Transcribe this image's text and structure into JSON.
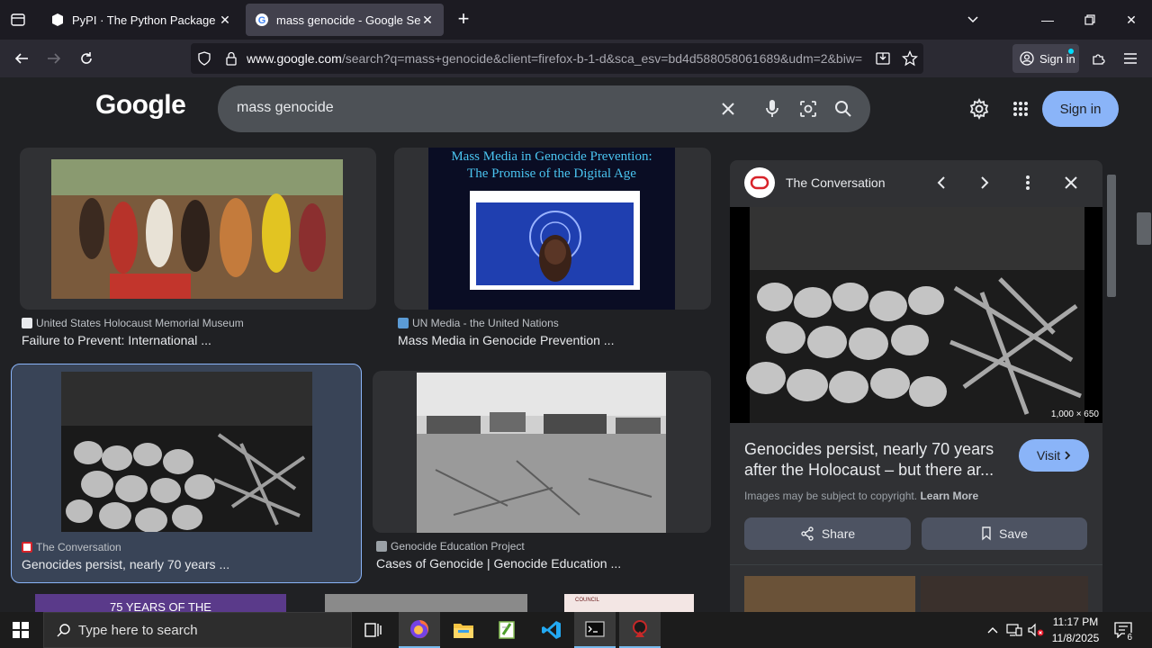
{
  "browser": {
    "tabs": [
      {
        "title": "PyPI · The Python Package Index",
        "active": false
      },
      {
        "title": "mass genocide - Google Search",
        "active": true
      }
    ],
    "url_host": "www.google.com",
    "url_rest": "/search?q=mass+genocide&client=firefox-b-1-d&sca_esv=bd4d588058061689&udm=2&biw=",
    "signin_label": "Sign in"
  },
  "google": {
    "logo": "Google",
    "query": "mass genocide",
    "signin_label": "Sign in"
  },
  "results": [
    {
      "source": "United States Holocaust Memorial Museum",
      "title": "Failure to Prevent: International ..."
    },
    {
      "source": "UN Media - the United Nations",
      "title": "Mass Media in Genocide Prevention ...",
      "image_caption_line1": "Mass Media in Genocide Prevention:",
      "image_caption_line2": "The Promise of the Digital Age"
    },
    {
      "source": "The Conversation",
      "title": "Genocides persist, nearly 70 years ...",
      "selected": true
    },
    {
      "source": "Genocide Education Project",
      "title": "Cases of Genocide | Genocide Education ..."
    },
    {
      "partial_text": "75 YEARS OF THE"
    },
    {
      "partial_text": "COUNCIL"
    }
  ],
  "panel": {
    "site": "The Conversation",
    "dimensions": "1,000 × 650",
    "title": "Genocides persist, nearly 70 years after the Holocaust – but there ar...",
    "visit_label": "Visit",
    "copyright_text": "Images may be subject to copyright.",
    "learn_more": "Learn More",
    "share_label": "Share",
    "save_label": "Save"
  },
  "taskbar": {
    "search_placeholder": "Type here to search",
    "time": "11:17 PM",
    "date": "11/8/2025",
    "notification_count": "6"
  },
  "colors": {
    "accent": "#8ab4f8",
    "page_bg": "#202124",
    "selected_bg": "#394457"
  }
}
